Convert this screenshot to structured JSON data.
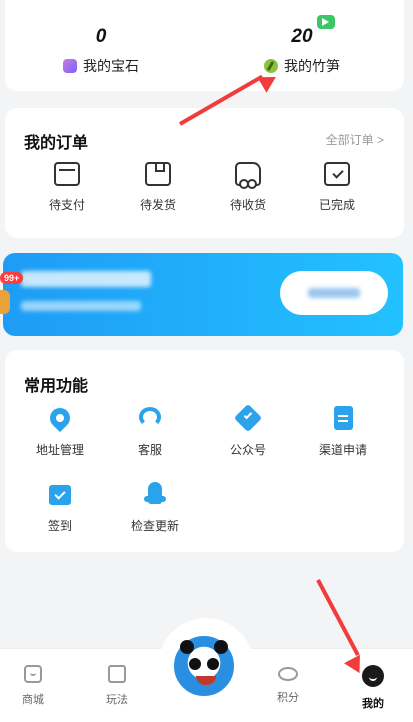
{
  "assets": {
    "gems": {
      "value": "0",
      "label": "我的宝石"
    },
    "bamboo": {
      "value": "20",
      "label": "我的竹笋"
    }
  },
  "orders": {
    "title": "我的订单",
    "all_link": "全部订单 >",
    "items": [
      {
        "label": "待支付",
        "icon": "card-icon"
      },
      {
        "label": "待发货",
        "icon": "box-icon"
      },
      {
        "label": "待收货",
        "icon": "truck-icon"
      },
      {
        "label": "已完成",
        "icon": "check-icon"
      }
    ]
  },
  "banner": {
    "badge": "99+"
  },
  "features": {
    "title": "常用功能",
    "items": [
      {
        "label": "地址管理",
        "icon": "location-pin-icon"
      },
      {
        "label": "客服",
        "icon": "headset-icon"
      },
      {
        "label": "公众号",
        "icon": "verified-badge-icon"
      },
      {
        "label": "渠道申请",
        "icon": "document-edit-icon"
      },
      {
        "label": "签到",
        "icon": "calendar-check-icon"
      },
      {
        "label": "检查更新",
        "icon": "rocket-icon"
      }
    ]
  },
  "tabbar": {
    "items": [
      {
        "label": "商城",
        "icon": "shop-bag-icon"
      },
      {
        "label": "玩法",
        "icon": "cube-icon"
      },
      {
        "label": "积分",
        "icon": "coin-stack-icon"
      },
      {
        "label": "我的",
        "icon": "profile-icon",
        "active": true
      }
    ]
  },
  "colors": {
    "accent": "#2aa3ec",
    "banner": "#1e9cf5",
    "annotation": "#f23b3b"
  }
}
